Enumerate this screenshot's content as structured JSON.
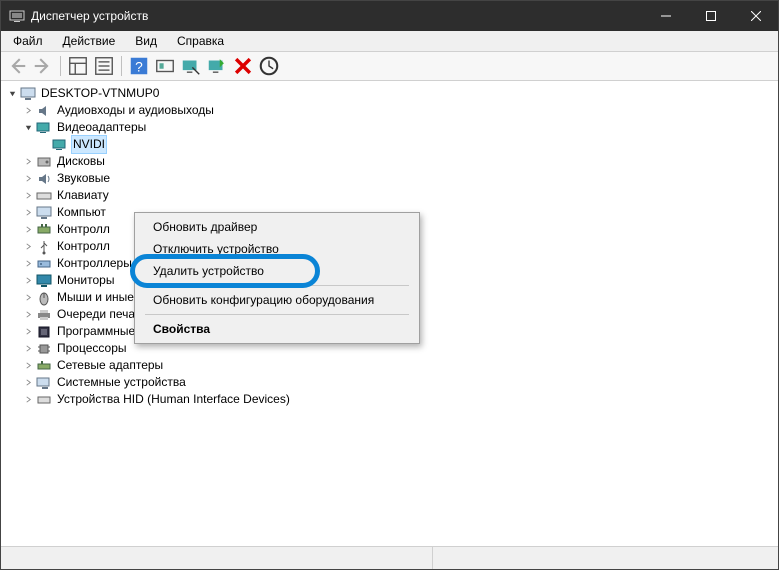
{
  "window": {
    "title": "Диспетчер устройств"
  },
  "menu": {
    "file": "Файл",
    "action": "Действие",
    "view": "Вид",
    "help": "Справка"
  },
  "tree": {
    "root": "DESKTOP-VTNMUP0",
    "audio": "Аудиовходы и аудиовыходы",
    "video": "Видеоадаптеры",
    "nvidia": "NVIDI",
    "disk": "Дисковы",
    "sound": "Звуковые",
    "keyboard": "Клавиату",
    "computer": "Компьют",
    "controller1": "Контролл",
    "controller2": "Контролл",
    "storage_ctrl": "Контроллеры запоминающих устройств",
    "monitors": "Мониторы",
    "mice": "Мыши и иные указывающие устройства",
    "print_queues": "Очереди печати",
    "software_devices": "Программные устройства",
    "processors": "Процессоры",
    "network": "Сетевые адаптеры",
    "system": "Системные устройства",
    "hid": "Устройства HID (Human Interface Devices)"
  },
  "context_menu": {
    "update_driver": "Обновить драйвер",
    "disable_device": "Отключить устройство",
    "uninstall_device": "Удалить устройство",
    "scan_hardware": "Обновить конфигурацию оборудования",
    "properties": "Свойства"
  }
}
